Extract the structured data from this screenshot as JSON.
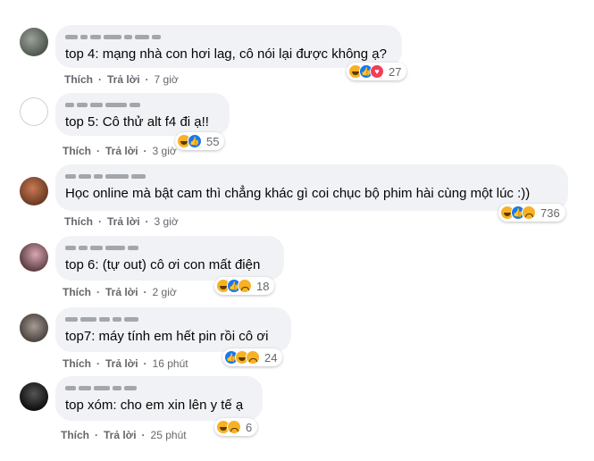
{
  "colors": {
    "bubble": "#f0f2f5",
    "meta": "#65676b",
    "text": "#050505",
    "like": "#1877f2",
    "haha": "#f7b125",
    "love": "#f33e58"
  },
  "comments": [
    {
      "text": "top 4: mạng nhà con hơi lag, cô nói lại được không ạ?",
      "like_label": "Thích",
      "reply_label": "Trả lời",
      "time": "7 giờ",
      "reactions": [
        "haha",
        "like",
        "love"
      ],
      "reaction_count": "27"
    },
    {
      "text": "top 5: Cô thử alt f4 đi ạ!!",
      "like_label": "Thích",
      "reply_label": "Trả lời",
      "time": "3 giờ",
      "reactions": [
        "haha",
        "like"
      ],
      "reaction_count": "55"
    },
    {
      "text": "Học online mà bật cam thì chẳng khác gì coi chục bộ phim hài cùng một lúc :))",
      "like_label": "Thích",
      "reply_label": "Trả lời",
      "time": "3 giờ",
      "reactions": [
        "haha",
        "like",
        "sad"
      ],
      "reaction_count": "736"
    },
    {
      "text": "top 6: (tự out) cô ơi con mất điện",
      "like_label": "Thích",
      "reply_label": "Trả lời",
      "time": "2 giờ",
      "reactions": [
        "haha",
        "like",
        "sad"
      ],
      "reaction_count": "18"
    },
    {
      "text": "top7: máy tính em hết pin rồi cô ơi",
      "like_label": "Thích",
      "reply_label": "Trả lời",
      "time": "16 phút",
      "reactions": [
        "like",
        "haha",
        "sad"
      ],
      "reaction_count": "24"
    },
    {
      "text": "top xóm: cho em xin lên y tế ạ",
      "like_label": "Thích",
      "reply_label": "Trả lời",
      "time": "25 phút",
      "reactions": [
        "haha",
        "sad"
      ],
      "reaction_count": "6"
    }
  ]
}
